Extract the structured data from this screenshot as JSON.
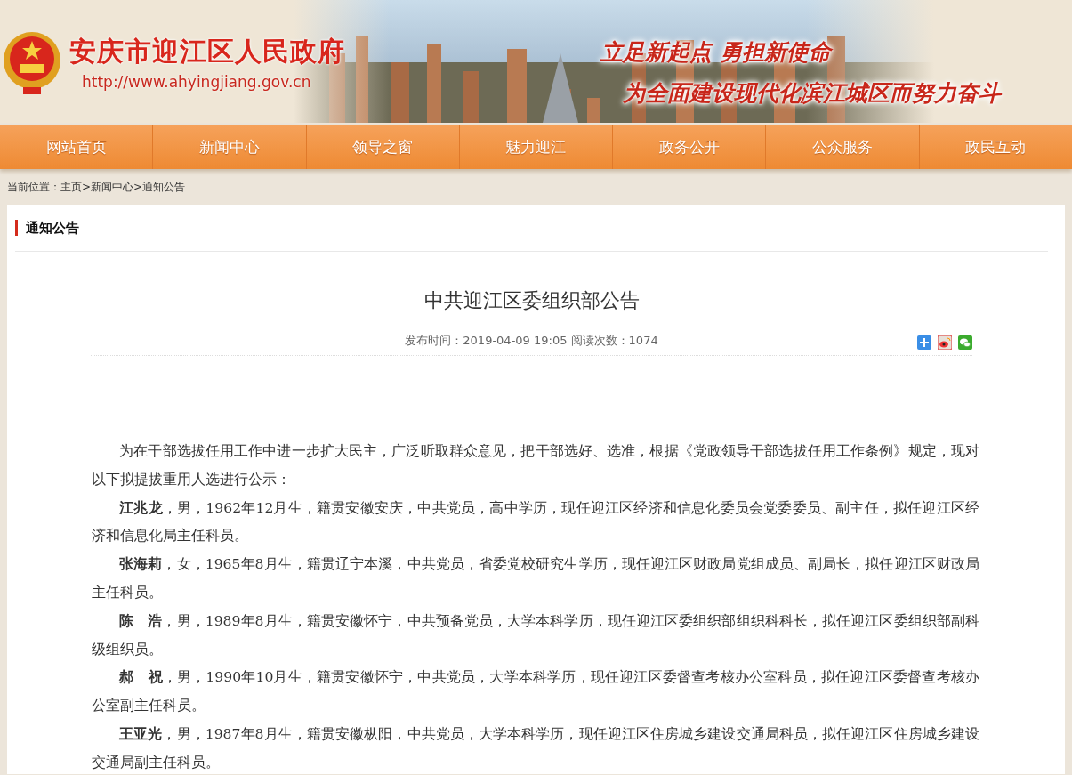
{
  "header": {
    "site_title": "安庆市迎江区人民政府",
    "site_url": "http://www.ahyingjiang.gov.cn",
    "slogans": [
      "立足新起点 勇担新使命",
      "为全面建设现代化滨江城区而努力奋斗"
    ]
  },
  "nav": [
    {
      "label": "网站首页"
    },
    {
      "label": "新闻中心"
    },
    {
      "label": "领导之窗"
    },
    {
      "label": "魅力迎江"
    },
    {
      "label": "政务公开"
    },
    {
      "label": "公众服务"
    },
    {
      "label": "政民互动"
    }
  ],
  "breadcrumb": "当前位置：主页>新闻中心>通知公告",
  "section_title": "通知公告",
  "article": {
    "title": "中共迎江区委组织部公告",
    "meta": "发布时间：2019-04-09 19:05 阅读次数：1074",
    "share": [
      {
        "kind": "plus"
      },
      {
        "kind": "weibo"
      },
      {
        "kind": "wechat"
      }
    ],
    "paragraphs": [
      "为在干部选拔任用工作中进一步扩大民主，广泛听取群众意见，把干部选好、选准，根据《党政领导干部选拔任用工作条例》规定，现对以下拟提拔重用人选进行公示：",
      "**江兆龙**，男，1962年12月生，籍贯安徽安庆，中共党员，高中学历，现任迎江区经济和信息化委员会党委委员、副主任，拟任迎江区经济和信息化局主任科员。",
      "**张海莉**，女，1965年8月生，籍贯辽宁本溪，中共党员，省委党校研究生学历，现任迎江区财政局党组成员、副局长，拟任迎江区财政局主任科员。",
      "**陈　浩**，男，1989年8月生，籍贯安徽怀宁，中共预备党员，大学本科学历，现任迎江区委组织部组织科科长，拟任迎江区委组织部副科级组织员。",
      "**郝　祝**，男，1990年10月生，籍贯安徽怀宁，中共党员，大学本科学历，现任迎江区委督查考核办公室科员，拟任迎江区委督查考核办公室副主任科员。",
      "**王亚光**，男，1987年8月生，籍贯安徽枞阳，中共党员，大学本科学历，现任迎江区住房城乡建设交通局科员，拟任迎江区住房城乡建设交通局副主任科员。"
    ]
  }
}
